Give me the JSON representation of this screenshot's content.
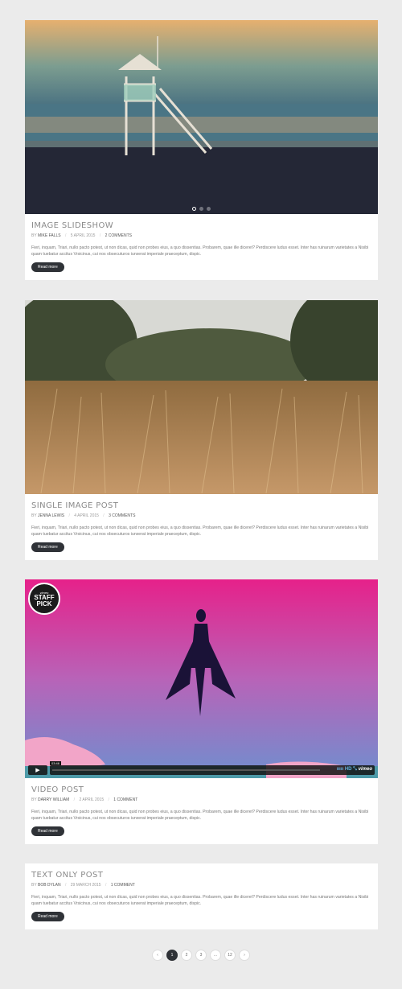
{
  "posts": [
    {
      "title": "IMAGE SLIDESHOW",
      "by": "BY",
      "author": "MIKE FALLS",
      "date": "5 APRIL 2015",
      "comments": "2 COMMENTS",
      "excerpt": "Fieri, inquam, Triari, nullo pacto potest, ut non dicas, quid non probes eius, a quo dissentias. Probarem, quae ille diceret? Perdiscere ludus esset. Inter has ruinarum varietates a Nisibi quam tuebatur accitus Vrsicinus, cui nos obsecuturos iunxerat imperiale praeceptum, dispic.",
      "readmore": "Read more"
    },
    {
      "title": "SINGLE IMAGE POST",
      "by": "BY",
      "author": "JENNA LEWIS",
      "date": "4 APRIL 2015",
      "comments": "3 COMMENTS",
      "excerpt": "Fieri, inquam, Triari, nullo pacto potest, ut non dicas, quid non probes eius, a quo dissentias. Probarem, quae ille diceret? Perdiscere ludus esset. Inter has ruinarum varietates a Nisibi quam tuebatur accitus Vrsicinus, cui nos obsecuturos iunxerat imperiale praeceptum, dispic.",
      "readmore": "Read more"
    },
    {
      "title": "VIDEO POST",
      "by": "BY",
      "author": "DARRY WILLIAM",
      "date": "2 APRIL 2015",
      "comments": "1 COMMENT",
      "excerpt": "Fieri, inquam, Triari, nullo pacto potest, ut non dicas, quid non probes eius, a quo dissentias. Probarem, quae ille diceret? Perdiscere ludus esset. Inter has ruinarum varietates a Nisibi quam tuebatur accitus Vrsicinus, cui nos obsecuturos iunxerat imperiale praeceptum, dispic.",
      "readmore": "Read more"
    },
    {
      "title": "TEXT ONLY POST",
      "by": "BY",
      "author": "BOB DYLAN",
      "date": "29 MARCH 2015",
      "comments": "1 COMMENT",
      "excerpt": "Fieri, inquam, Triari, nullo pacto potest, ut non dicas, quid non probes eius, a quo dissentias. Probarem, quae ille diceret? Perdiscere ludus esset. Inter has ruinarum varietates a Nisibi quam tuebatur accitus Vrsicinus, cui nos obsecuturos iunxerat imperiale praeceptum, dispic.",
      "readmore": "Read more"
    }
  ],
  "video": {
    "badge_top": "vimeo",
    "badge_main1": "STAFF",
    "badge_main2": "PICK",
    "time": "03:46",
    "hd": "HD",
    "brand": "vimeo"
  },
  "pagination": {
    "prev": "‹",
    "pages": [
      "1",
      "2",
      "3",
      "...",
      "12"
    ],
    "active_page": "1",
    "next": "›"
  },
  "colors": {
    "button_dark": "#2f3237",
    "page_bg": "#ebebeb",
    "accent_blue": "#66b3e0"
  }
}
